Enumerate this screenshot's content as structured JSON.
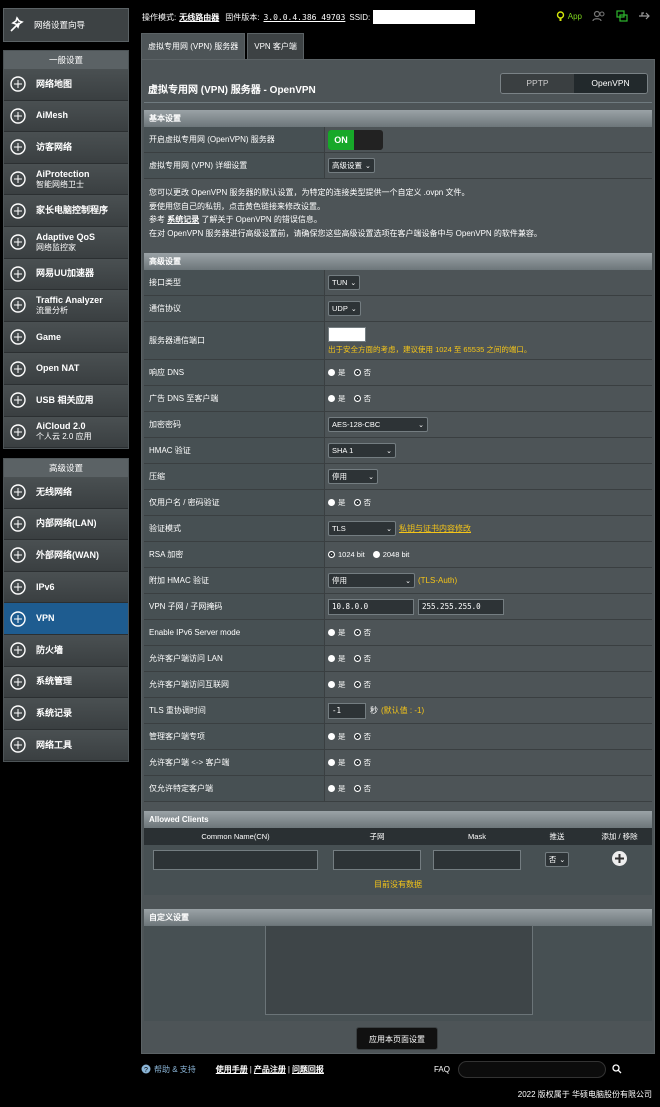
{
  "qis": {
    "label": "网络设置向导"
  },
  "general": {
    "header": "一般设置",
    "items": [
      {
        "label": "网络地图",
        "icon": "network-map-icon"
      },
      {
        "label": "AiMesh",
        "icon": "aimesh-icon"
      },
      {
        "label": "访客网络",
        "icon": "guest-network-icon"
      },
      {
        "label": "AiProtection",
        "sub": "智能网络卫士",
        "icon": "aiprotection-icon"
      },
      {
        "label": "家长电脑控制程序",
        "icon": "parental-controls-icon"
      },
      {
        "label": "Adaptive QoS",
        "sub": "网络监控家",
        "icon": "qos-icon"
      },
      {
        "label": "网易UU加速器",
        "icon": "uu-booster-icon"
      },
      {
        "label": "Traffic Analyzer",
        "sub": "流量分析",
        "icon": "traffic-analyzer-icon"
      },
      {
        "label": "Game",
        "icon": "game-icon"
      },
      {
        "label": "Open NAT",
        "icon": "open-nat-icon"
      },
      {
        "label": "USB 相关应用",
        "icon": "usb-icon"
      },
      {
        "label": "AiCloud 2.0",
        "sub": "个人云 2.0 应用",
        "icon": "aicloud-icon"
      }
    ]
  },
  "advanced": {
    "header": "高级设置",
    "items": [
      {
        "label": "无线网络",
        "icon": "wireless-icon"
      },
      {
        "label": "内部网络(LAN)",
        "icon": "lan-icon"
      },
      {
        "label": "外部网络(WAN)",
        "icon": "wan-icon"
      },
      {
        "label": "IPv6",
        "icon": "ipv6-icon"
      },
      {
        "label": "VPN",
        "icon": "vpn-icon"
      },
      {
        "label": "防火墙",
        "icon": "firewall-icon"
      },
      {
        "label": "系统管理",
        "icon": "administration-icon"
      },
      {
        "label": "系统记录",
        "icon": "system-log-icon"
      },
      {
        "label": "网络工具",
        "icon": "network-tools-icon"
      }
    ]
  },
  "topbar": {
    "mode_label": "操作模式:",
    "mode": "无线路由器",
    "fw_label": "固件版本:",
    "fw": "3.0.0.4.386_49703",
    "ssid_label": "SSID:",
    "app": "App"
  },
  "tabs": [
    "虚拟专用网 (VPN) 服务器",
    "VPN 客户端"
  ],
  "page": {
    "title": "虚拟专用网 (VPN) 服务器 - OpenVPN",
    "seg": [
      "PPTP",
      "OpenVPN"
    ]
  },
  "basic": {
    "header": "基本设置",
    "enable_label": "开启虚拟专用网 (OpenVPN) 服务器",
    "toggle": "ON",
    "detail_label": "虚拟专用网 (VPN) 详细设置",
    "detail_value": "高级设置"
  },
  "notes": {
    "l1": "您可以更改 OpenVPN 服务器的默认设置，为特定的连接类型提供一个自定义 .ovpn 文件。",
    "l2": "要使用您自己的私钥，点击黄色链接来修改设置。",
    "l3a": "参考 ",
    "l3link": "系统记录",
    "l3b": " 了解关于 OpenVPN 的错误信息。",
    "l4": "在对 OpenVPN 服务器进行高级设置前，请确保您这些高级设置选项在客户端设备中与 OpenVPN 的软件兼容。"
  },
  "adv": {
    "header": "高级设置",
    "iface": {
      "label": "接口类型",
      "value": "TUN"
    },
    "proto": {
      "label": "通信协议",
      "value": "UDP"
    },
    "port": {
      "label": "服务器通信端口",
      "value": "",
      "hint": "出于安全方面的考虑，建议使用 1024 至 65535 之间的端口。"
    },
    "dns": {
      "label": "响应 DNS",
      "yes": "是",
      "no": "否"
    },
    "adv_dns": {
      "label": "广告 DNS 至客户端",
      "yes": "是",
      "no": "否"
    },
    "cipher": {
      "label": "加密密码",
      "value": "AES-128-CBC"
    },
    "hmac": {
      "label": "HMAC 验证",
      "value": "SHA 1"
    },
    "comp": {
      "label": "压缩",
      "value": "停用"
    },
    "userpass": {
      "label": "仅用户名 / 密码验证",
      "yes": "是",
      "no": "否"
    },
    "auth": {
      "label": "验证模式",
      "value": "TLS",
      "link": "私钥与证书内容修改"
    },
    "rsa": {
      "label": "RSA 加密",
      "a": "1024 bit",
      "b": "2048 bit"
    },
    "tlsauth": {
      "label": "附加 HMAC 验证",
      "value": "停用",
      "note": "(TLS-Auth)"
    },
    "subnet": {
      "label": "VPN 子网 / 子网掩码",
      "ip": "10.8.0.0",
      "mask": "255.255.255.0"
    },
    "ipv6": {
      "label": "Enable IPv6 Server mode",
      "yes": "是",
      "no": "否"
    },
    "lan": {
      "label": "允许客户端访问 LAN",
      "yes": "是",
      "no": "否"
    },
    "inet": {
      "label": "允许客户端访问互联网",
      "yes": "是",
      "no": "否"
    },
    "tls": {
      "label": "TLS 重协调时间",
      "value": "-1",
      "unit": "秒",
      "def": "(默认值 : -1)"
    },
    "mgmt": {
      "label": "管理客户端专项",
      "yes": "是",
      "no": "否"
    },
    "c2c": {
      "label": "允许客户端 <-> 客户端",
      "yes": "是",
      "no": "否"
    },
    "only": {
      "label": "仅允许特定客户端",
      "yes": "是",
      "no": "否"
    }
  },
  "clients": {
    "header": "Allowed Clients",
    "cols": [
      "Common Name(CN)",
      "子网",
      "Mask",
      "推送",
      "添加 / 移除"
    ],
    "push": "否",
    "nodata": "目前没有数据"
  },
  "custom": {
    "header": "自定义设置"
  },
  "apply": "应用本页面设置",
  "footer": {
    "help": "帮助 & 支持",
    "manual": "使用手册",
    "reg": "产品注册",
    "feedback": "问题回报",
    "faq": "FAQ"
  },
  "copyright": "2022 版权属于 华硕电脑股份有限公司"
}
